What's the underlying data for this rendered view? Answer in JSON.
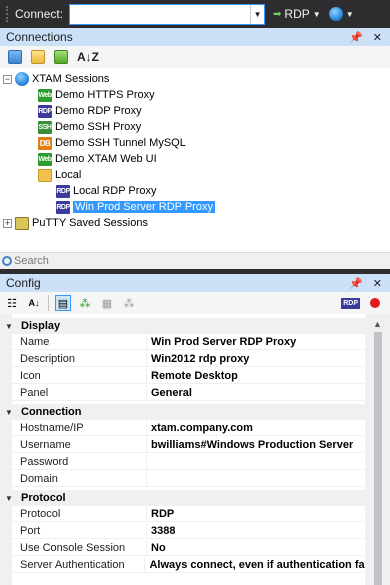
{
  "toolbar": {
    "connect_label": "Connect:",
    "connect_value": "",
    "rdp_label": "RDP",
    "icons": [
      "dropdown-arrow",
      "rdp-arrow",
      "globe"
    ]
  },
  "connections_panel": {
    "title": "Connections",
    "pin": "$",
    "close": "✕",
    "sort_label": "A↓Z"
  },
  "tree": {
    "root": "XTAM Sessions",
    "items": [
      {
        "type": "Web",
        "label": "Demo HTTPS Proxy"
      },
      {
        "type": "RDP",
        "label": "Demo RDP Proxy"
      },
      {
        "type": "SSH",
        "label": "Demo SSH Proxy"
      },
      {
        "type": "DB",
        "label": "Demo SSH Tunnel MySQL"
      },
      {
        "type": "Web",
        "label": "Demo XTAM Web UI"
      }
    ],
    "folder": "Local",
    "folder_items": [
      {
        "type": "RDP",
        "label": "Local RDP Proxy"
      },
      {
        "type": "RDP",
        "label": "Win Prod Server RDP Proxy",
        "selected": true
      }
    ],
    "putty": "PuTTY Saved Sessions"
  },
  "search": {
    "placeholder": "Search"
  },
  "config_panel": {
    "title": "Config",
    "pin": "$",
    "close": "✕",
    "rdp_badge": "RDP"
  },
  "grid": {
    "display": {
      "category": "Display",
      "rows": [
        {
          "name": "Name",
          "value": "Win Prod Server RDP Proxy"
        },
        {
          "name": "Description",
          "value": "Win2012 rdp proxy"
        },
        {
          "name": "Icon",
          "value": "Remote Desktop"
        },
        {
          "name": "Panel",
          "value": "General"
        }
      ]
    },
    "connection": {
      "category": "Connection",
      "rows": [
        {
          "name": "Hostname/IP",
          "value": "xtam.company.com"
        },
        {
          "name": "Username",
          "value": "bwilliams#Windows Production Server"
        },
        {
          "name": "Password",
          "value": ""
        },
        {
          "name": "Domain",
          "value": ""
        }
      ]
    },
    "protocol": {
      "category": "Protocol",
      "rows": [
        {
          "name": "Protocol",
          "value": "RDP"
        },
        {
          "name": "Port",
          "value": "3388"
        },
        {
          "name": "Use Console Session",
          "value": "No"
        },
        {
          "name": "Server Authentication",
          "value": "Always connect, even if authentication fai"
        }
      ]
    }
  },
  "colors": {
    "accent": "#3399ff",
    "toolbar_bg": "#2d2d30",
    "panel_header": "#cce0f7"
  }
}
